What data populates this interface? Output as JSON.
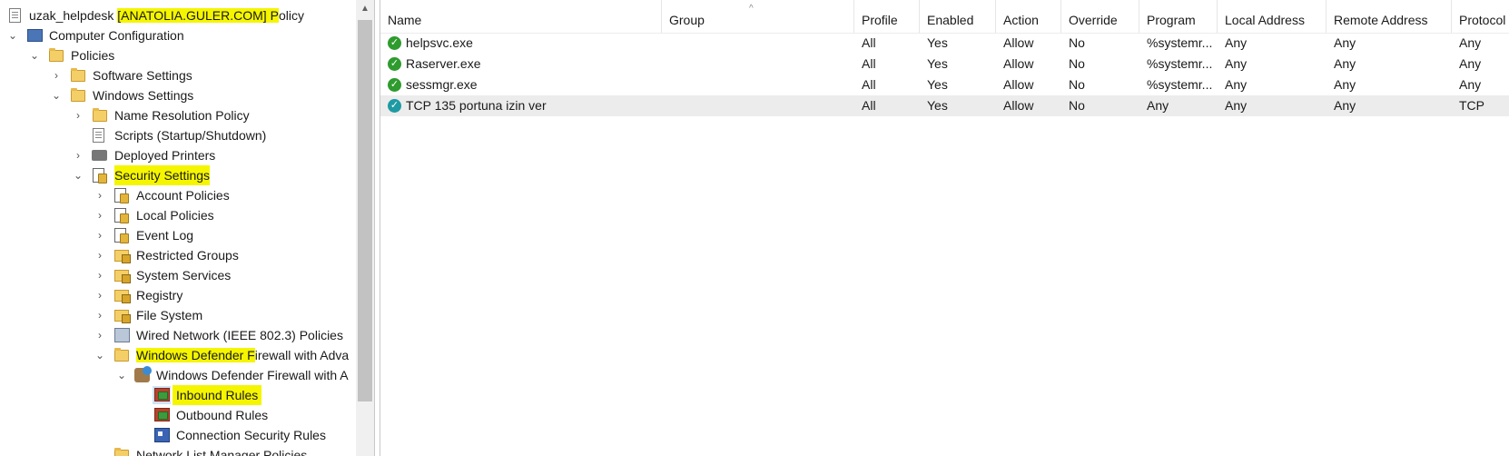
{
  "tree": {
    "root": {
      "prefix": "uzak_helpdesk ",
      "domain": "[ANATOLIA.GULER.COM]",
      "p": " P",
      "suffix": "olicy"
    },
    "items": [
      {
        "label": "Computer Configuration"
      },
      {
        "label": "Policies"
      },
      {
        "label": "Software Settings"
      },
      {
        "label": "Windows Settings"
      },
      {
        "label": "Name Resolution Policy"
      },
      {
        "label": "Scripts (Startup/Shutdown)"
      },
      {
        "label": "Deployed Printers"
      },
      {
        "label": "Security Settings"
      },
      {
        "label": "Account Policies"
      },
      {
        "label": "Local Policies"
      },
      {
        "label": "Event Log"
      },
      {
        "label": "Restricted Groups"
      },
      {
        "label": "System Services"
      },
      {
        "label": "Registry"
      },
      {
        "label": "File System"
      },
      {
        "label": "Wired Network (IEEE 802.3) Policies"
      },
      {
        "label_hl": "Windows Defender F",
        "label_rest": "irewall with Adva"
      },
      {
        "label": "Windows Defender Firewall with A"
      },
      {
        "label": "Inbound Rules"
      },
      {
        "label": "Outbound Rules"
      },
      {
        "label": "Connection Security Rules"
      },
      {
        "label": "Network List Manager Policies"
      }
    ]
  },
  "table": {
    "columns": [
      "Name",
      "Group",
      "Profile",
      "Enabled",
      "Action",
      "Override",
      "Program",
      "Local Address",
      "Remote Address",
      "Protocol"
    ],
    "rows": [
      {
        "name": "helpsvc.exe",
        "group": "",
        "profile": "All",
        "enabled": "Yes",
        "action": "Allow",
        "override": "No",
        "program": "%systemr...",
        "local": "Any",
        "remote": "Any",
        "protocol": "Any",
        "status": "green"
      },
      {
        "name": "Raserver.exe",
        "group": "",
        "profile": "All",
        "enabled": "Yes",
        "action": "Allow",
        "override": "No",
        "program": "%systemr...",
        "local": "Any",
        "remote": "Any",
        "protocol": "Any",
        "status": "green"
      },
      {
        "name": "sessmgr.exe",
        "group": "",
        "profile": "All",
        "enabled": "Yes",
        "action": "Allow",
        "override": "No",
        "program": "%systemr...",
        "local": "Any",
        "remote": "Any",
        "protocol": "Any",
        "status": "green"
      },
      {
        "name": "TCP 135 portuna izin ver",
        "group": "",
        "profile": "All",
        "enabled": "Yes",
        "action": "Allow",
        "override": "No",
        "program": "Any",
        "local": "Any",
        "remote": "Any",
        "protocol": "TCP",
        "status": "teal"
      }
    ]
  },
  "icons": {
    "checkmark": "✓",
    "expanded": "⌄",
    "collapsed": "›",
    "scroll_up": "▲",
    "sort_caret": "^"
  },
  "colors": {
    "highlight": "#f5f500",
    "selected_row": "#ececec",
    "status_green": "#2e9b2e",
    "status_teal": "#1e9aa3"
  }
}
